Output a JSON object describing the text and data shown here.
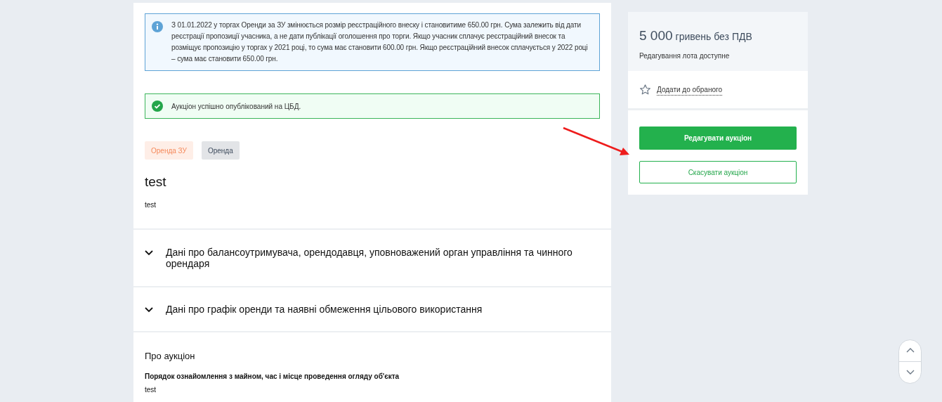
{
  "info_notice": "З 01.01.2022 у торгах Оренди за ЗУ змінюється розмір реєстраційного внеску і становитиме 650.00 грн. Сума залежить від дати реєстрації пропозиції учасника, а не дати публікації оголошення про торги. Якщо учасник сплачує реєстраційний внесок та розміщує пропозицію у торгах у 2021 році, то сума має становити 600.00 грн. Якщо реєстраційний внесок сплачується у 2022 році – сума має становити 650.00 грн.",
  "success_notice": "Аукціон успішно опублікований на ЦБД.",
  "tags": [
    {
      "label": "Оренда ЗУ",
      "color": "#f58a5c"
    },
    {
      "label": "Оренда",
      "color": "#3f4d5e"
    }
  ],
  "title": "test",
  "description": "test",
  "sections": [
    {
      "title": "Дані про балансоутримувача, орендодавця, уповноважений орган управління та чинного орендаря",
      "expanded": false
    },
    {
      "title": "Дані про графік оренди та наявні обмеження цільового використання",
      "expanded": false
    }
  ],
  "about": {
    "heading": "Про аукціон",
    "fields": [
      {
        "label": "Порядок ознайомлення з майном, час і місце проведення огляду об'єкта",
        "value": "test"
      }
    ]
  },
  "sidebar": {
    "price": "5 000",
    "price_unit": "гривень без ПДВ",
    "status": "Редагування лота доступне",
    "favorite_link": "Додати до обраного",
    "edit_button": "Редагувати аукціон",
    "cancel_button": "Скасувати аукціон"
  }
}
